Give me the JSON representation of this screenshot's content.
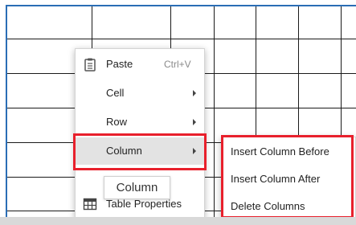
{
  "context_menu": {
    "items": [
      {
        "label": "Paste",
        "shortcut": "Ctrl+V",
        "icon": "clipboard-icon",
        "has_submenu": false
      },
      {
        "label": "Cell",
        "has_submenu": true
      },
      {
        "label": "Row",
        "has_submenu": true
      },
      {
        "label": "Column",
        "has_submenu": true,
        "highlighted": true
      },
      {
        "label": "Table Properties",
        "icon": "table-icon",
        "has_submenu": false
      }
    ]
  },
  "tooltip": {
    "text": "Column"
  },
  "submenu": {
    "items": [
      {
        "label": "Insert Column Before"
      },
      {
        "label": "Insert Column After"
      },
      {
        "label": "Delete Columns"
      }
    ]
  },
  "colors": {
    "annotation": "#e8202c",
    "table_border": "#2a6db5",
    "grid_line": "#1a1a1a",
    "highlight": "#e3e3e3"
  }
}
